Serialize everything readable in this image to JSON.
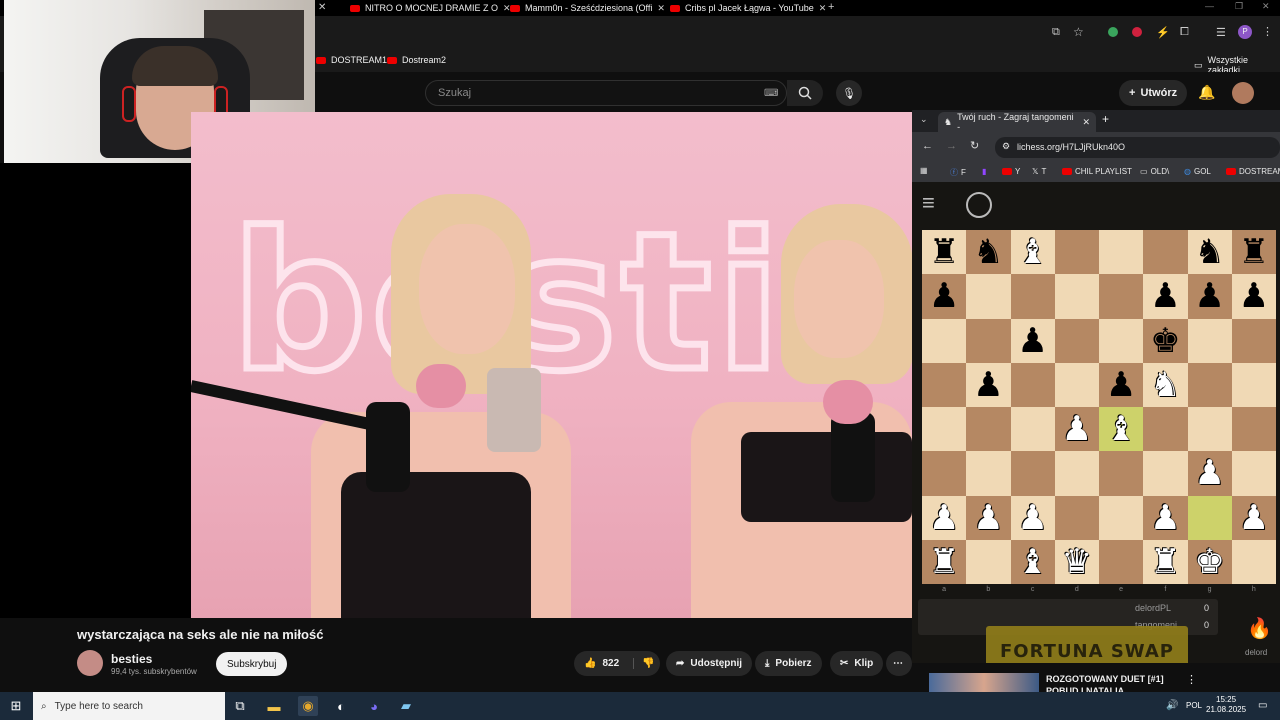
{
  "browser": {
    "tabs": [
      {
        "label": "NITRO O MOCNEJ DRAMIE Z O"
      },
      {
        "label": "Mamm0n - Sześćdziesiona (Offi"
      },
      {
        "label": "Cribs pl Jacek Łągwa - YouTube"
      }
    ],
    "bookmarks": [
      {
        "label": "DOSTREAM1"
      },
      {
        "label": "Dostream2"
      }
    ],
    "all_bookmarks_label": "Wszystkie zakładki"
  },
  "youtube": {
    "search_placeholder": "Szukaj",
    "create_label": "Utwórz",
    "video_title": "wystarczająca na seks ale nie na miłość",
    "neon_sign": "besties",
    "channel": {
      "name": "besties",
      "subscribers": "99,4 tys. subskrybentów"
    },
    "subscribe_label": "Subskrybuj",
    "likes": "822",
    "share_label": "Udostępnij",
    "download_label": "Pobierz",
    "clip_label": "Klip"
  },
  "lichess": {
    "tab_title": "Twój ruch - Zagraj tangomeni -",
    "url": "lichess.org/H7LJjRUkn40O",
    "bookmarks": [
      {
        "label": "F"
      },
      {
        "label": "Y"
      },
      {
        "label": "T"
      },
      {
        "label": "CHIL PLAYLIST"
      },
      {
        "label": "OLD\\"
      },
      {
        "label": "GOL"
      },
      {
        "label": "DOSTREAM"
      }
    ],
    "board": [
      [
        "bR",
        "bN",
        "wB",
        "",
        "",
        "",
        "bN",
        "bR"
      ],
      [
        "bP",
        "",
        "",
        "",
        "",
        "bP",
        "bP",
        "bP"
      ],
      [
        "",
        "",
        "bP",
        "",
        "",
        "bK",
        "",
        ""
      ],
      [
        "",
        "bP",
        "",
        "",
        "bP",
        "wN",
        "",
        ""
      ],
      [
        "",
        "",
        "",
        "wP",
        "wB",
        "",
        "",
        ""
      ],
      [
        "",
        "",
        "",
        "",
        "",
        "",
        "wP",
        ""
      ],
      [
        "wP",
        "wP",
        "wP",
        "",
        "",
        "wP",
        "",
        "wP"
      ],
      [
        "wR",
        "",
        "wB",
        "wQ",
        "",
        "wR",
        "wK",
        ""
      ]
    ],
    "highlighted_squares": [
      "e4",
      "g2"
    ],
    "files": [
      "a",
      "b",
      "c",
      "d",
      "e",
      "f",
      "g",
      "h"
    ],
    "players": [
      {
        "name": "delordPL",
        "score": "0"
      },
      {
        "name": "tangomeni",
        "score": "0"
      }
    ],
    "overlay_text": "FORTUNA SWAP",
    "side_label": "delord"
  },
  "recommended": {
    "title_line1": "ROZGOTOWANY DUET [#1]",
    "title_line2": "POBUD I NATALIA"
  },
  "taskbar": {
    "search_placeholder": "Type here to search",
    "language": "POL",
    "time": "15:25",
    "date": "21.08.2025"
  }
}
